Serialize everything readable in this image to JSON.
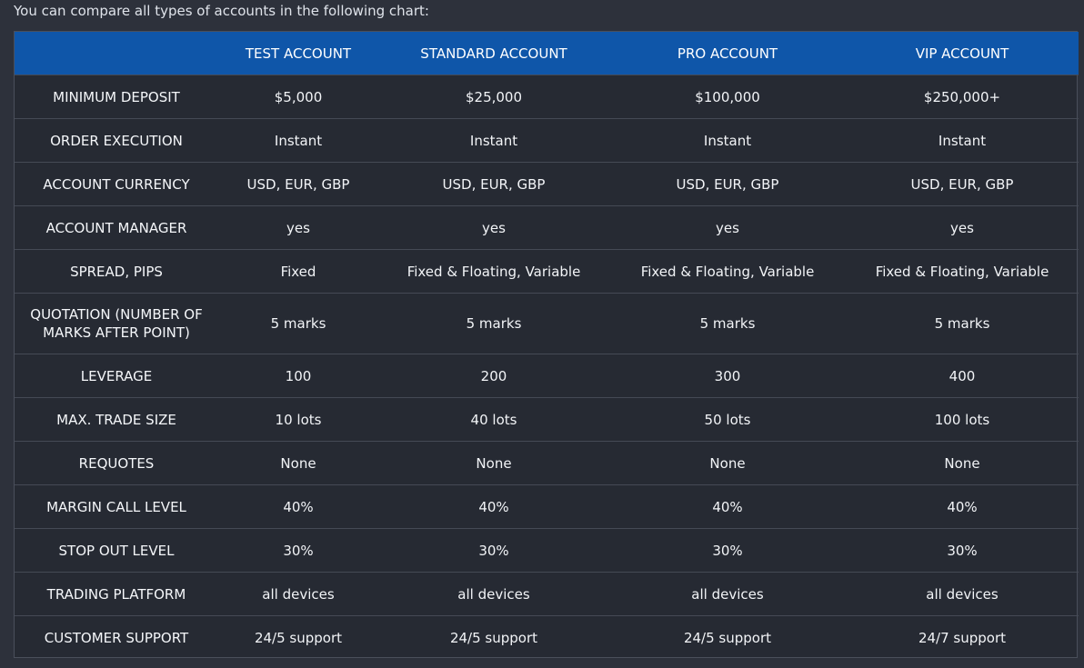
{
  "intro": "You can compare all types of accounts in the following chart:",
  "header": {
    "blank": "",
    "columns": [
      "TEST ACCOUNT",
      "STANDARD ACCOUNT",
      "PRO ACCOUNT",
      "VIP ACCOUNT"
    ]
  },
  "rows": [
    {
      "label": "MINIMUM DEPOSIT",
      "values": [
        "$5,000",
        "$25,000",
        "$100,000",
        "$250,000+"
      ]
    },
    {
      "label": "ORDER EXECUTION",
      "values": [
        "Instant",
        "Instant",
        "Instant",
        "Instant"
      ]
    },
    {
      "label": "ACCOUNT CURRENCY",
      "values": [
        "USD, EUR, GBP",
        "USD, EUR, GBP",
        "USD, EUR, GBP",
        "USD, EUR, GBP"
      ]
    },
    {
      "label": "ACCOUNT MANAGER",
      "values": [
        "yes",
        "yes",
        "yes",
        "yes"
      ]
    },
    {
      "label": "SPREAD, PIPS",
      "values": [
        "Fixed",
        "Fixed & Floating, Variable",
        "Fixed & Floating, Variable",
        "Fixed & Floating, Variable"
      ]
    },
    {
      "label": "QUOTATION (NUMBER OF MARKS AFTER POINT)",
      "values": [
        "5 marks",
        "5 marks",
        "5 marks",
        "5 marks"
      ]
    },
    {
      "label": "LEVERAGE",
      "values": [
        "100",
        "200",
        "300",
        "400"
      ]
    },
    {
      "label": "MAX. TRADE SIZE",
      "values": [
        "10 lots",
        "40 lots",
        "50 lots",
        "100 lots"
      ]
    },
    {
      "label": "REQUOTES",
      "values": [
        "None",
        "None",
        "None",
        "None"
      ]
    },
    {
      "label": "MARGIN CALL LEVEL",
      "values": [
        "40%",
        "40%",
        "40%",
        "40%"
      ]
    },
    {
      "label": "STOP OUT LEVEL",
      "values": [
        "30%",
        "30%",
        "30%",
        "30%"
      ]
    },
    {
      "label": "TRADING PLATFORM",
      "values": [
        "all devices",
        "all devices",
        "all devices",
        "all devices"
      ]
    },
    {
      "label": "CUSTOMER SUPPORT",
      "values": [
        "24/5 support",
        "24/5 support",
        "24/5 support",
        "24/7 support"
      ]
    }
  ],
  "colors": {
    "page_background": "#2d313b",
    "table_background": "#262a33",
    "header_background": "#0f56a9",
    "row_divider": "#454a55"
  }
}
